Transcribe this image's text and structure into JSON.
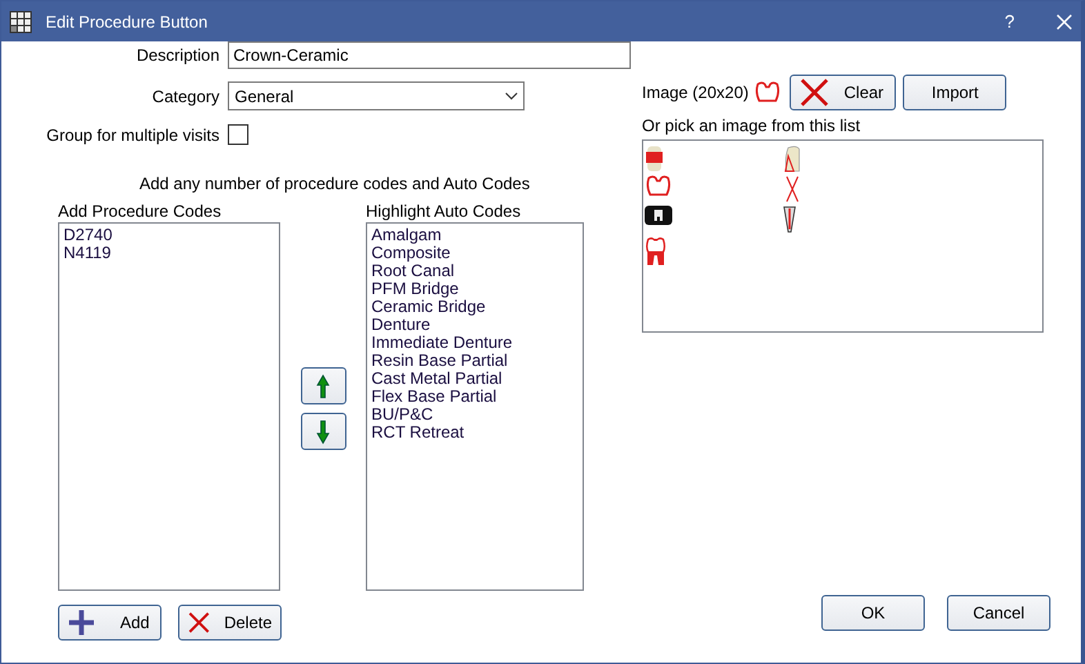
{
  "window": {
    "title": "Edit Procedure Button",
    "help": "?"
  },
  "description": {
    "label": "Description",
    "value": "Crown-Ceramic"
  },
  "category": {
    "label": "Category",
    "value": "General"
  },
  "group_multiple_visits": {
    "label": "Group for multiple visits",
    "checked": false
  },
  "instructions": "Add any number of procedure codes and Auto Codes",
  "procedure_codes": {
    "label": "Add Procedure Codes",
    "items": [
      "D2740",
      "N4119"
    ]
  },
  "auto_codes": {
    "label": "Highlight Auto Codes",
    "items": [
      "Amalgam",
      "Composite",
      "Root Canal",
      "PFM Bridge",
      "Ceramic Bridge",
      "Denture",
      "Immediate Denture",
      "Resin Base Partial",
      "Cast Metal Partial",
      "Flex Base Partial",
      "BU/P&C",
      "RCT Retreat"
    ]
  },
  "image": {
    "label": "Image (20x20)",
    "clear": "Clear",
    "import": "Import",
    "pick_label": "Or pick an image from this list"
  },
  "buttons": {
    "add": "Add",
    "delete": "Delete",
    "ok": "OK",
    "cancel": "Cancel"
  }
}
